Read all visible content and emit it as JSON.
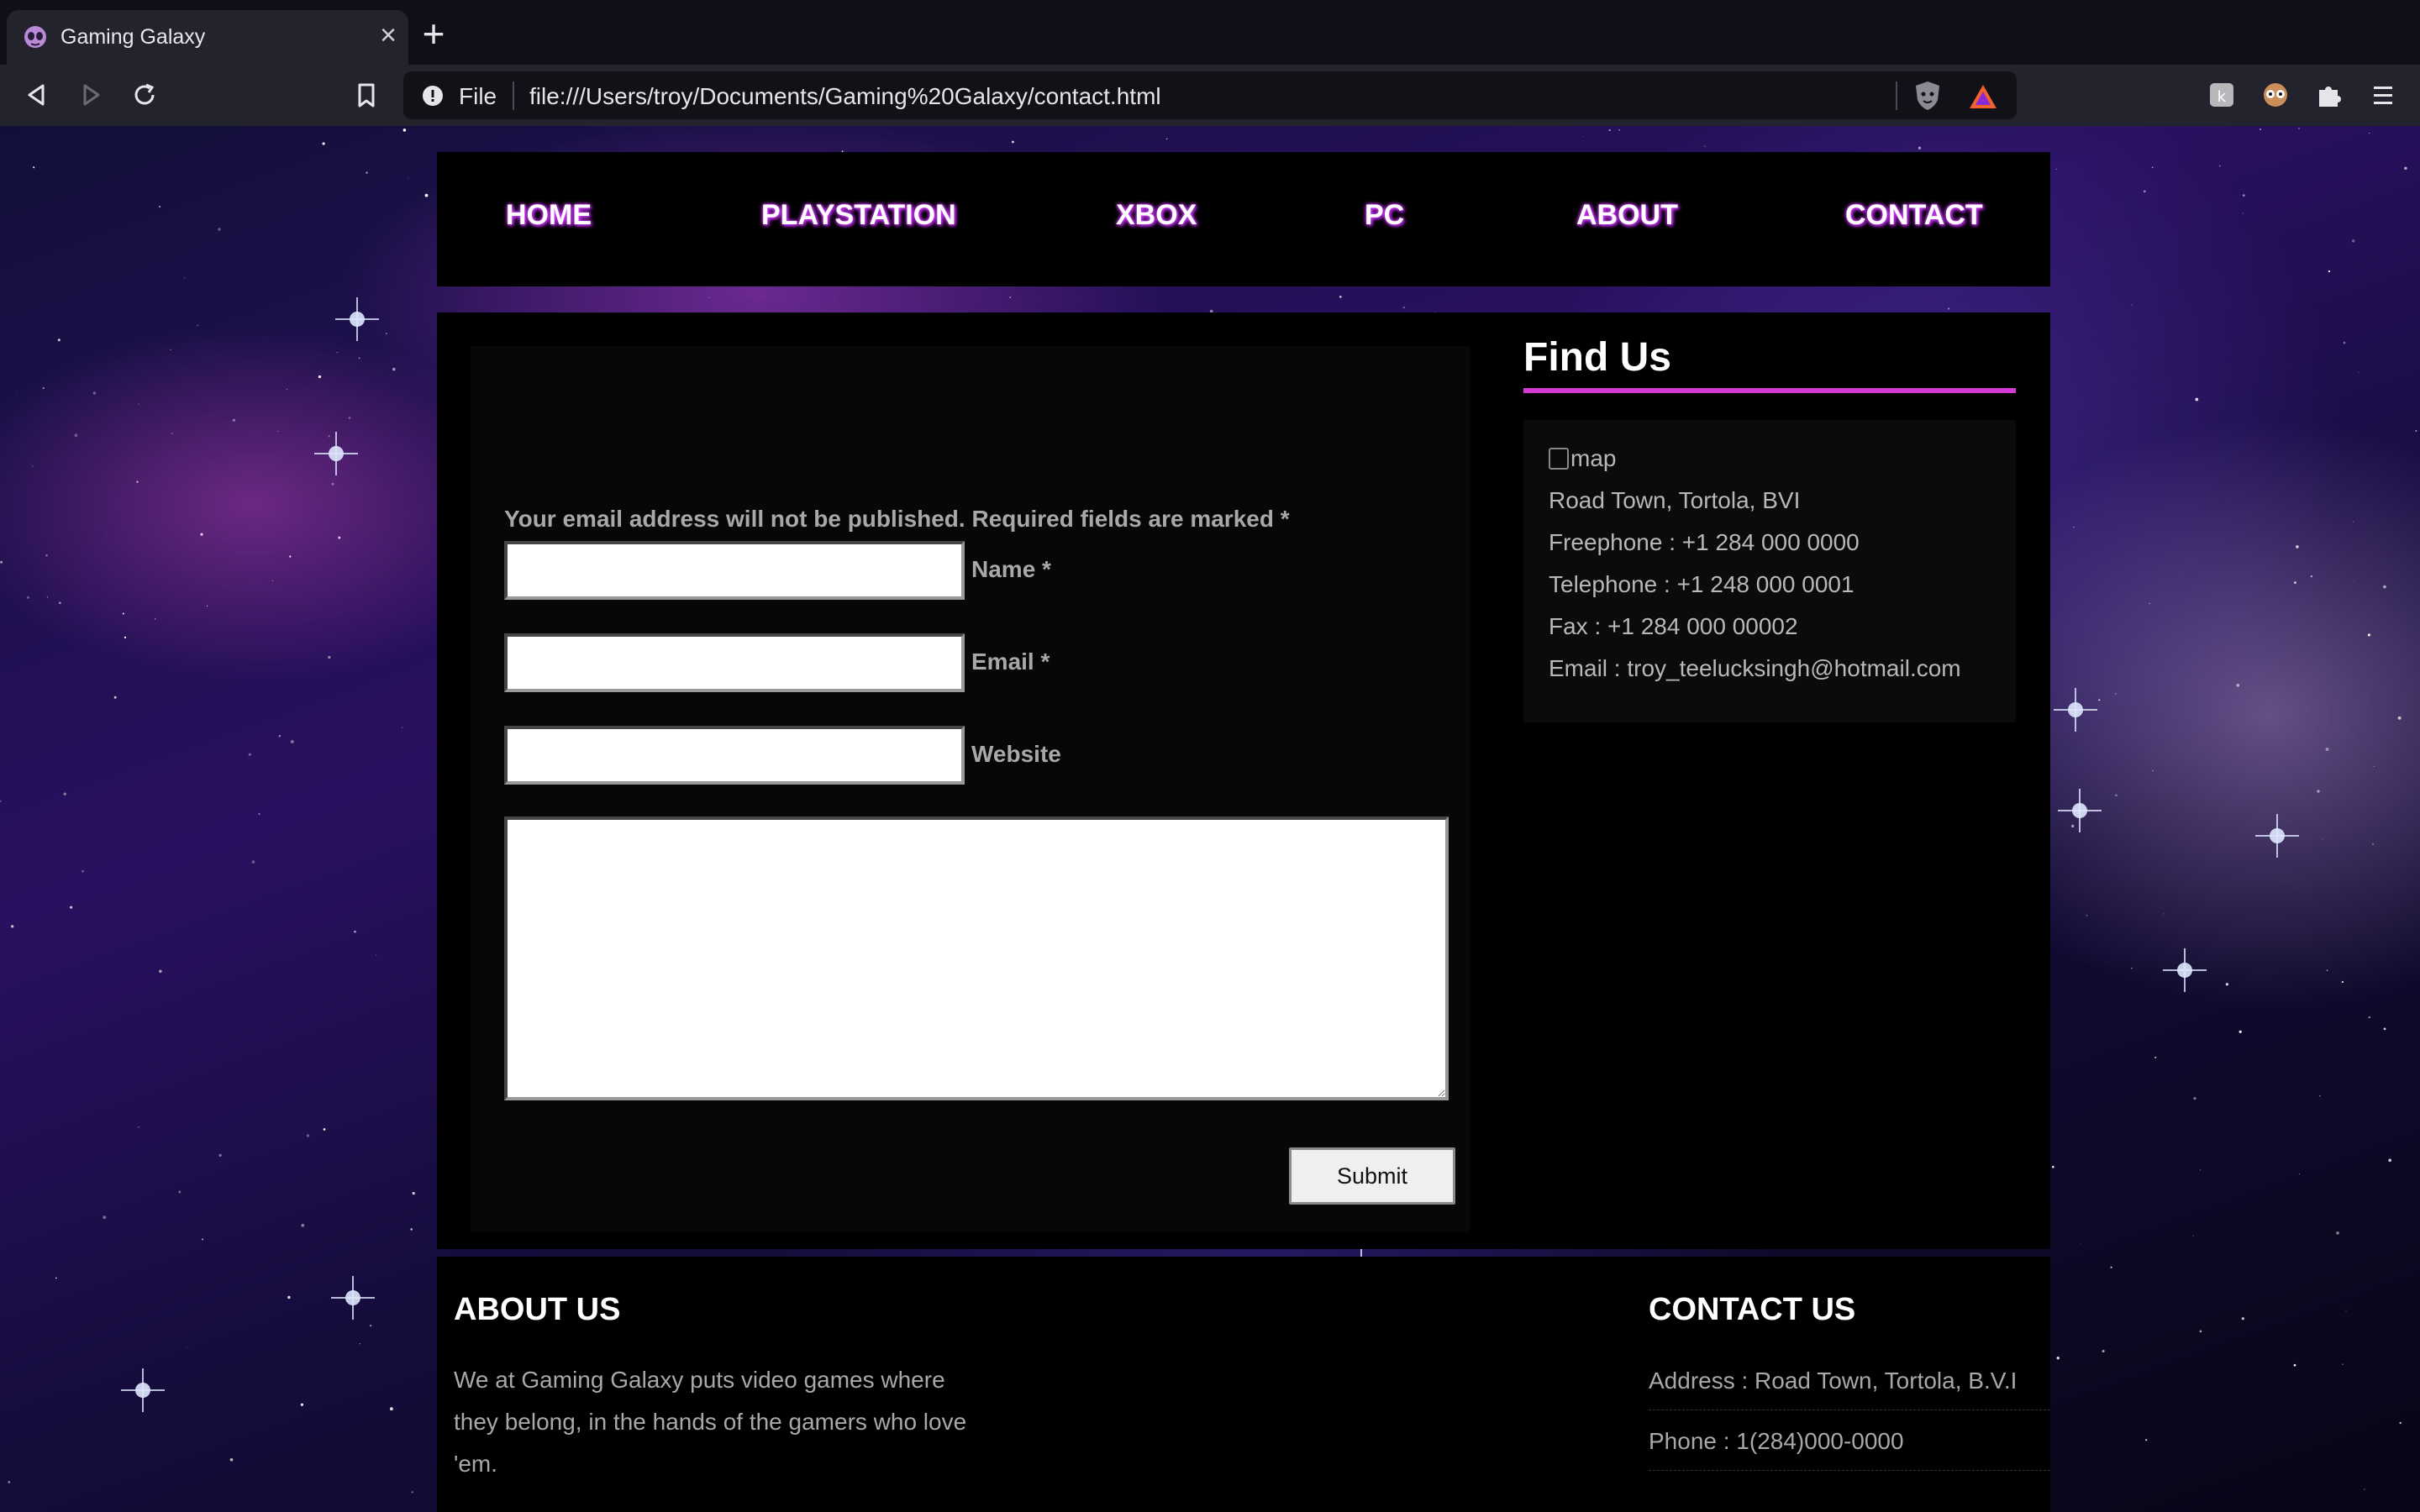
{
  "browser": {
    "tab_title": "Gaming Galaxy",
    "tab_close": "×",
    "new_tab": "+",
    "scheme_label": "File",
    "url": "file:///Users/troy/Documents/Gaming%20Galaxy/contact.html",
    "icons": [
      "alien-favicon-icon",
      "back-icon",
      "forward-icon",
      "reload-icon",
      "bookmark-icon",
      "info-icon",
      "brave-shield-icon",
      "brave-rewards-icon",
      "extension-k-icon",
      "extension-owl-icon",
      "extensions-puzzle-icon",
      "menu-icon"
    ],
    "accent": "#d63ad6"
  },
  "nav": {
    "items": [
      {
        "label": "HOME"
      },
      {
        "label": "PLAYSTATION"
      },
      {
        "label": "XBOX"
      },
      {
        "label": "PC"
      },
      {
        "label": "ABOUT"
      },
      {
        "label": "CONTACT"
      }
    ],
    "glow_color": "#d23cff"
  },
  "form": {
    "notes": "Your email address will not be published. Required fields are marked *",
    "fields": [
      {
        "label": "Name *",
        "value": ""
      },
      {
        "label": "Email *",
        "value": ""
      },
      {
        "label": "Website",
        "value": ""
      }
    ],
    "comment_value": "",
    "submit_label": "Submit"
  },
  "find_us": {
    "title": "Find Us",
    "map_alt": "map",
    "lines": [
      "Road Town, Tortola, BVI",
      "Freephone : +1 284 000 0000",
      "Telephone : +1 248 000 0001",
      "Fax : +1 284 000 00002",
      "Email : troy_teelucksingh@hotmail.com"
    ]
  },
  "footer": {
    "about_title": "ABOUT US",
    "about_text": "We at Gaming Galaxy puts video games where they belong, in the hands of the gamers who love 'em.",
    "contact_title": "CONTACT US",
    "contact_lines": [
      "Address : Road Town, Tortola, B.V.I",
      "Phone : 1(284)000-0000"
    ]
  }
}
